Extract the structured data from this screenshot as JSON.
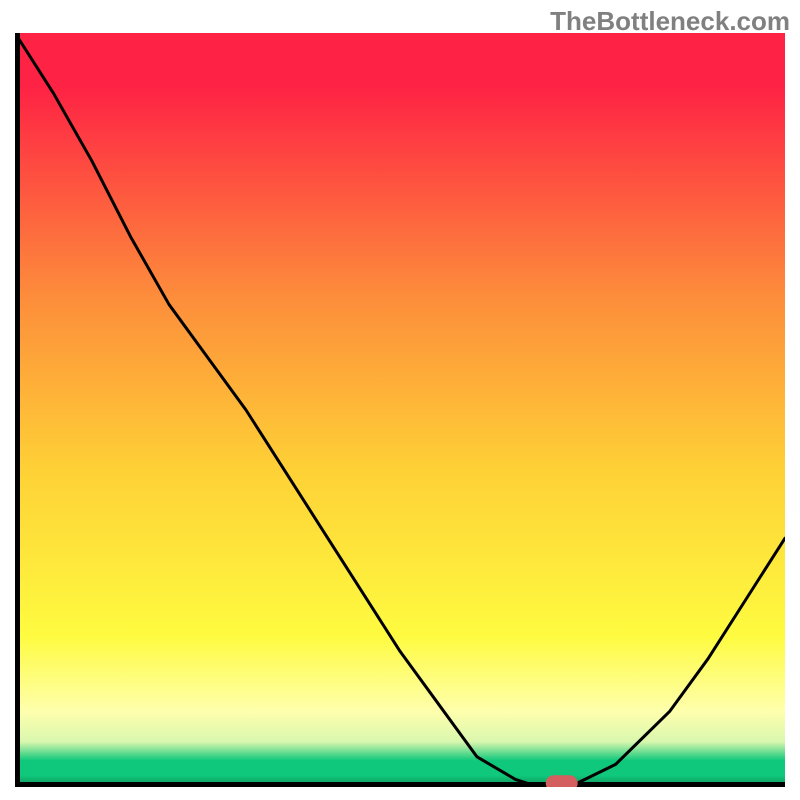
{
  "watermark": "TheBottleneck.com",
  "chart_data": {
    "type": "line",
    "title": "",
    "xlabel": "",
    "ylabel": "",
    "x": [
      0.0,
      0.05,
      0.1,
      0.15,
      0.2,
      0.25,
      0.3,
      0.35,
      0.4,
      0.45,
      0.5,
      0.55,
      0.6,
      0.65,
      0.68,
      0.72,
      0.78,
      0.85,
      0.9,
      0.95,
      1.0
    ],
    "values": [
      1.0,
      0.92,
      0.83,
      0.73,
      0.64,
      0.57,
      0.5,
      0.42,
      0.34,
      0.26,
      0.18,
      0.11,
      0.04,
      0.01,
      0.0,
      0.0,
      0.03,
      0.1,
      0.17,
      0.25,
      0.33
    ],
    "xlim": [
      0,
      1
    ],
    "ylim": [
      0,
      1
    ],
    "marker": {
      "x": 0.71,
      "y": 0.005,
      "color": "#d35f5f"
    },
    "gradient_colors": {
      "top": "#fe2244",
      "mid_upper": "#fd8d3b",
      "mid": "#fed136",
      "mid_lower": "#fefb40",
      "green": "#0fc87b",
      "bottom_dark": "#108d57"
    },
    "axis_color": "#000000"
  }
}
